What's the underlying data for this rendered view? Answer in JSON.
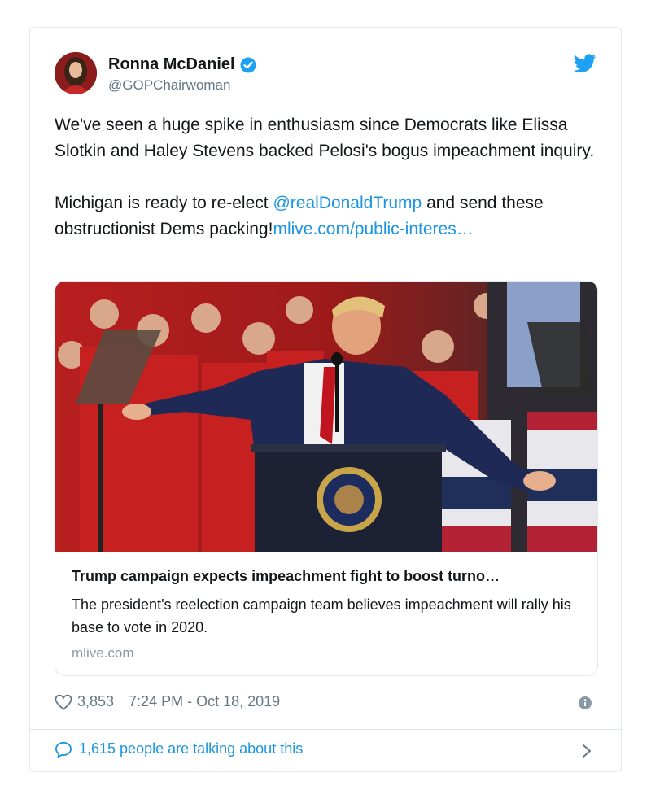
{
  "author": {
    "name": "Ronna McDaniel",
    "handle": "@GOPChairwoman",
    "verified": true
  },
  "tweet": {
    "paragraph1": "We've seen a huge spike in enthusiasm since Democrats like Elissa Slotkin and Haley Stevens backed Pelosi's bogus impeachment inquiry.",
    "p2_before": "Michigan is ready to re-elect ",
    "p2_mention": "@realDonaldTrump",
    "p2_after": " and send these obstructionist Dems packing!",
    "p2_link": "mlive.com/public-interes…"
  },
  "card": {
    "title": "Trump campaign expects impeachment fight to boost turno…",
    "description": "The president's reelection campaign team believes impeachment will rally his base to vote in 2020.",
    "domain": "mlive.com"
  },
  "footer": {
    "likes": "3,853",
    "timestamp": "7:24 PM - Oct 18, 2019",
    "talking": "1,615 people are talking about this"
  },
  "colors": {
    "link": "#1b95e0",
    "muted": "#657786",
    "border": "#e1e8ed"
  },
  "icons": [
    "verified-badge-icon",
    "twitter-bird-icon",
    "heart-icon",
    "info-icon",
    "comment-bubble-icon",
    "chevron-right-icon"
  ]
}
